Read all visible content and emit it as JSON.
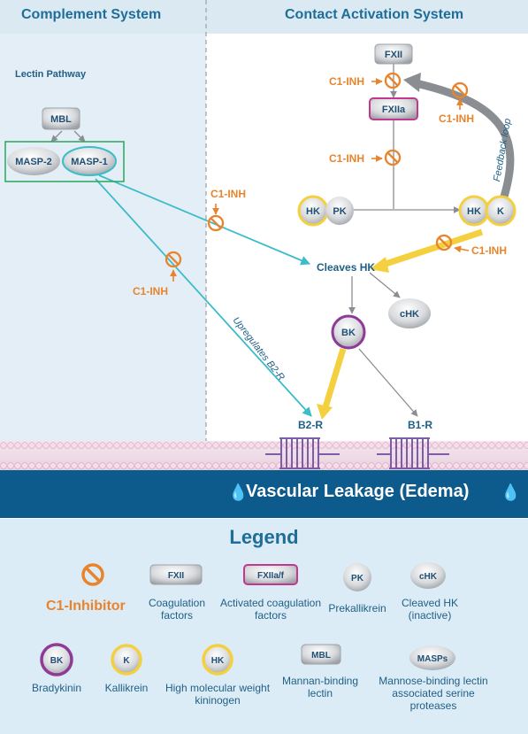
{
  "headers": {
    "complement": "Complement System",
    "contact": "Contact Activation System"
  },
  "lectin_pathway": "Lectin Pathway",
  "nodes": {
    "mbl": "MBL",
    "masp2": "MASP-2",
    "masp1": "MASP-1",
    "fxii": "FXII",
    "fxiia": "FXIIa",
    "hk_left": "HK",
    "pk": "PK",
    "hk_right": "HK",
    "k": "K",
    "bk": "BK",
    "chk": "cHK",
    "cleaves_hk": "Cleaves HK",
    "b2r": "B2-R",
    "b1r": "B1-R"
  },
  "inhibitor_label": "C1-INH",
  "annotations": {
    "feedback": "Feedback loop",
    "upregulates": "Upregulates B2-R"
  },
  "edema": "Vascular Leakage (Edema)",
  "legend": {
    "title": "Legend",
    "c1_inhibitor": "C1-Inhibitor",
    "items": [
      {
        "symbol": "FXII",
        "desc": "Coagulation factors"
      },
      {
        "symbol": "FXIIa/f",
        "desc": "Activated coagulation factors"
      },
      {
        "symbol": "PK",
        "desc": "Prekallikrein"
      },
      {
        "symbol": "cHK",
        "desc": "Cleaved HK (inactive)"
      },
      {
        "symbol": "BK",
        "desc": "Bradykinin"
      },
      {
        "symbol": "K",
        "desc": "Kallikrein"
      },
      {
        "symbol": "HK",
        "desc": "High molecular weight kininogen"
      },
      {
        "symbol": "MBL",
        "desc": "Mannan-binding lectin"
      },
      {
        "symbol": "MASPs",
        "desc": "Mannose-binding lectin associated serine proteases"
      }
    ]
  },
  "colors": {
    "teal": "#3bbcc9",
    "yellow": "#f4d03f",
    "orange": "#e8842c",
    "purple": "#8e3a96",
    "blue": "#1f6e9a",
    "magenta": "#c2388f",
    "gray_arrow": "#8a8d91"
  }
}
